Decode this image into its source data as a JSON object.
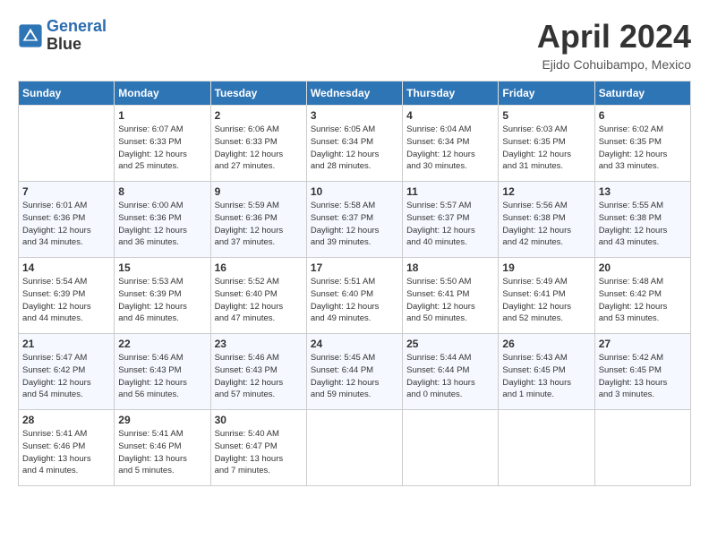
{
  "header": {
    "logo_line1": "General",
    "logo_line2": "Blue",
    "month_title": "April 2024",
    "location": "Ejido Cohuibampo, Mexico"
  },
  "columns": [
    "Sunday",
    "Monday",
    "Tuesday",
    "Wednesday",
    "Thursday",
    "Friday",
    "Saturday"
  ],
  "weeks": [
    {
      "days": [
        {
          "num": "",
          "info": ""
        },
        {
          "num": "1",
          "info": "Sunrise: 6:07 AM\nSunset: 6:33 PM\nDaylight: 12 hours\nand 25 minutes."
        },
        {
          "num": "2",
          "info": "Sunrise: 6:06 AM\nSunset: 6:33 PM\nDaylight: 12 hours\nand 27 minutes."
        },
        {
          "num": "3",
          "info": "Sunrise: 6:05 AM\nSunset: 6:34 PM\nDaylight: 12 hours\nand 28 minutes."
        },
        {
          "num": "4",
          "info": "Sunrise: 6:04 AM\nSunset: 6:34 PM\nDaylight: 12 hours\nand 30 minutes."
        },
        {
          "num": "5",
          "info": "Sunrise: 6:03 AM\nSunset: 6:35 PM\nDaylight: 12 hours\nand 31 minutes."
        },
        {
          "num": "6",
          "info": "Sunrise: 6:02 AM\nSunset: 6:35 PM\nDaylight: 12 hours\nand 33 minutes."
        }
      ]
    },
    {
      "days": [
        {
          "num": "7",
          "info": "Sunrise: 6:01 AM\nSunset: 6:36 PM\nDaylight: 12 hours\nand 34 minutes."
        },
        {
          "num": "8",
          "info": "Sunrise: 6:00 AM\nSunset: 6:36 PM\nDaylight: 12 hours\nand 36 minutes."
        },
        {
          "num": "9",
          "info": "Sunrise: 5:59 AM\nSunset: 6:36 PM\nDaylight: 12 hours\nand 37 minutes."
        },
        {
          "num": "10",
          "info": "Sunrise: 5:58 AM\nSunset: 6:37 PM\nDaylight: 12 hours\nand 39 minutes."
        },
        {
          "num": "11",
          "info": "Sunrise: 5:57 AM\nSunset: 6:37 PM\nDaylight: 12 hours\nand 40 minutes."
        },
        {
          "num": "12",
          "info": "Sunrise: 5:56 AM\nSunset: 6:38 PM\nDaylight: 12 hours\nand 42 minutes."
        },
        {
          "num": "13",
          "info": "Sunrise: 5:55 AM\nSunset: 6:38 PM\nDaylight: 12 hours\nand 43 minutes."
        }
      ]
    },
    {
      "days": [
        {
          "num": "14",
          "info": "Sunrise: 5:54 AM\nSunset: 6:39 PM\nDaylight: 12 hours\nand 44 minutes."
        },
        {
          "num": "15",
          "info": "Sunrise: 5:53 AM\nSunset: 6:39 PM\nDaylight: 12 hours\nand 46 minutes."
        },
        {
          "num": "16",
          "info": "Sunrise: 5:52 AM\nSunset: 6:40 PM\nDaylight: 12 hours\nand 47 minutes."
        },
        {
          "num": "17",
          "info": "Sunrise: 5:51 AM\nSunset: 6:40 PM\nDaylight: 12 hours\nand 49 minutes."
        },
        {
          "num": "18",
          "info": "Sunrise: 5:50 AM\nSunset: 6:41 PM\nDaylight: 12 hours\nand 50 minutes."
        },
        {
          "num": "19",
          "info": "Sunrise: 5:49 AM\nSunset: 6:41 PM\nDaylight: 12 hours\nand 52 minutes."
        },
        {
          "num": "20",
          "info": "Sunrise: 5:48 AM\nSunset: 6:42 PM\nDaylight: 12 hours\nand 53 minutes."
        }
      ]
    },
    {
      "days": [
        {
          "num": "21",
          "info": "Sunrise: 5:47 AM\nSunset: 6:42 PM\nDaylight: 12 hours\nand 54 minutes."
        },
        {
          "num": "22",
          "info": "Sunrise: 5:46 AM\nSunset: 6:43 PM\nDaylight: 12 hours\nand 56 minutes."
        },
        {
          "num": "23",
          "info": "Sunrise: 5:46 AM\nSunset: 6:43 PM\nDaylight: 12 hours\nand 57 minutes."
        },
        {
          "num": "24",
          "info": "Sunrise: 5:45 AM\nSunset: 6:44 PM\nDaylight: 12 hours\nand 59 minutes."
        },
        {
          "num": "25",
          "info": "Sunrise: 5:44 AM\nSunset: 6:44 PM\nDaylight: 13 hours\nand 0 minutes."
        },
        {
          "num": "26",
          "info": "Sunrise: 5:43 AM\nSunset: 6:45 PM\nDaylight: 13 hours\nand 1 minute."
        },
        {
          "num": "27",
          "info": "Sunrise: 5:42 AM\nSunset: 6:45 PM\nDaylight: 13 hours\nand 3 minutes."
        }
      ]
    },
    {
      "days": [
        {
          "num": "28",
          "info": "Sunrise: 5:41 AM\nSunset: 6:46 PM\nDaylight: 13 hours\nand 4 minutes."
        },
        {
          "num": "29",
          "info": "Sunrise: 5:41 AM\nSunset: 6:46 PM\nDaylight: 13 hours\nand 5 minutes."
        },
        {
          "num": "30",
          "info": "Sunrise: 5:40 AM\nSunset: 6:47 PM\nDaylight: 13 hours\nand 7 minutes."
        },
        {
          "num": "",
          "info": ""
        },
        {
          "num": "",
          "info": ""
        },
        {
          "num": "",
          "info": ""
        },
        {
          "num": "",
          "info": ""
        }
      ]
    }
  ]
}
